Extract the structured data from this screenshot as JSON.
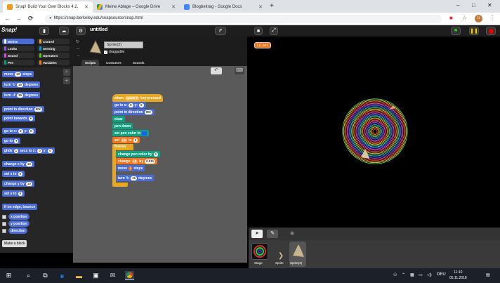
{
  "browser": {
    "tabs": [
      {
        "title": "Snap! Build Your Own Blocks 4.2.",
        "color": "#f39a1c",
        "active": true
      },
      {
        "title": "Meine Ablage – Google Drive",
        "color": "#f4b400",
        "active": false
      },
      {
        "title": "Blogbeitrag - Google Docs",
        "color": "#4285f4",
        "active": false
      }
    ],
    "new_tab": "+",
    "min": "–",
    "max": "□",
    "close": "✕",
    "back": "←",
    "forward": "→",
    "reload": "C",
    "url": "https://snap.berkeley.edu/snapsource/snap.html",
    "lock": "🔒",
    "star": "☆",
    "avatar": "U",
    "menu": "⋮"
  },
  "snap": {
    "logo": "Snap!",
    "project_title": "untitled",
    "categories": [
      {
        "label": "Motion",
        "color": "#4a6cd4",
        "selected": true
      },
      {
        "label": "Control",
        "color": "#e6a822",
        "selected": false
      },
      {
        "label": "Looks",
        "color": "#8f56e3",
        "selected": false
      },
      {
        "label": "Sensing",
        "color": "#0494dc",
        "selected": false
      },
      {
        "label": "Sound",
        "color": "#cf4ad9",
        "selected": false
      },
      {
        "label": "Operators",
        "color": "#62c213",
        "selected": false
      },
      {
        "label": "Pen",
        "color": "#00a178",
        "selected": false
      },
      {
        "label": "Variables",
        "color": "#f3761d",
        "selected": false
      }
    ],
    "palette": {
      "move": {
        "text": "move",
        "val": "10",
        "suffix": "steps"
      },
      "turn_cw": {
        "text": "turn",
        "icon": "↻",
        "val": "15",
        "suffix": "degrees"
      },
      "turn_ccw": {
        "text": "turn",
        "icon": "↺",
        "val": "15",
        "suffix": "degrees"
      },
      "point_dir": {
        "text": "point in direction",
        "val": "90▾"
      },
      "point_towards": {
        "text": "point towards",
        "val": "▾"
      },
      "goto_xy": {
        "text": "go to x:",
        "x": "0",
        "y_label": "y:",
        "y": "0"
      },
      "goto": {
        "text": "go to",
        "val": "▾"
      },
      "glide": {
        "text": "glide",
        "secs": "1",
        "mid": "secs to x:",
        "x": "0",
        "y_label": "y:",
        "y": "0"
      },
      "change_x": {
        "text": "change x by",
        "val": "10"
      },
      "set_x": {
        "text": "set x to",
        "val": "0"
      },
      "change_y": {
        "text": "change y by",
        "val": "10"
      },
      "set_y": {
        "text": "set y to",
        "val": "0"
      },
      "bounce": {
        "text": "if on edge, bounce"
      },
      "x_position": "x position",
      "y_position": "y position",
      "direction": "direction",
      "make_block": "Make a block"
    },
    "sprite": {
      "name": "Sprite(2)",
      "draggable": "draggable",
      "check": "✓",
      "tabs": [
        "Scripts",
        "Costumes",
        "Sounds"
      ]
    },
    "script": {
      "hat": {
        "text": "when",
        "key": "space ▾",
        "suffix": "key pressed"
      },
      "goto": {
        "text": "go to x:",
        "x": "0",
        "y_label": "y:",
        "y": "0"
      },
      "point": {
        "text": "point in direction",
        "val": "90▾"
      },
      "clear": "clear",
      "pen_down": "pen down",
      "set_color": {
        "text": "set pen color to"
      },
      "set_var": {
        "text": "set",
        "var": "i ▾",
        "to": "to",
        "val": "0"
      },
      "forever": "forever",
      "change_pen": {
        "text": "change pen color by",
        "val": "1"
      },
      "change_var": {
        "text": "change",
        "var": "i ▾",
        "by": "by",
        "val": "0.011"
      },
      "move": {
        "text": "move",
        "val": "i",
        "suffix": "steps"
      },
      "turn": {
        "text": "turn",
        "icon": "↻",
        "val": "15",
        "suffix": "degrees"
      }
    },
    "stage": {
      "watcher": "i 11.967"
    },
    "corral": {
      "stage_label": "Stage",
      "sprite_label": "Sprite",
      "sprite2_label": "Sprite(2)"
    }
  },
  "taskbar": {
    "start": "⊞",
    "search": "⌕",
    "lang": "DEU",
    "time": "11:10",
    "date": "05.11.2018"
  }
}
